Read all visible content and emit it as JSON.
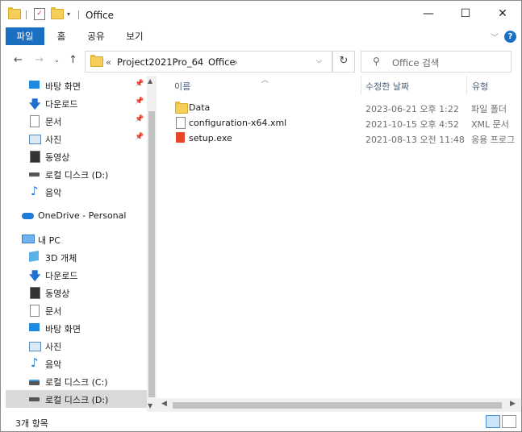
{
  "window": {
    "title": "Office"
  },
  "ribbon": {
    "tabs": [
      "파일",
      "홈",
      "공유",
      "보기"
    ],
    "help": "?"
  },
  "address": {
    "overflow": "«",
    "crumbs": [
      "Project2021Pro_64",
      "Office"
    ],
    "separator": "›"
  },
  "search": {
    "placeholder": "Office 검색"
  },
  "sidebar": {
    "quick_access": [
      {
        "label": "바탕 화면",
        "icon": "desktop-icon",
        "pinned": true
      },
      {
        "label": "다운로드",
        "icon": "download-icon",
        "pinned": true
      },
      {
        "label": "문서",
        "icon": "documents-icon",
        "pinned": true
      },
      {
        "label": "사진",
        "icon": "pictures-icon",
        "pinned": true
      },
      {
        "label": "동영상",
        "icon": "videos-icon",
        "pinned": false
      },
      {
        "label": "로컬 디스크 (D:)",
        "icon": "drive-icon",
        "pinned": false
      },
      {
        "label": "음악",
        "icon": "music-icon",
        "pinned": false
      }
    ],
    "onedrive": "OneDrive - Personal",
    "this_pc": "내 PC",
    "pc_items": [
      {
        "label": "3D 개체",
        "icon": "3d-objects-icon"
      },
      {
        "label": "다운로드",
        "icon": "download-icon"
      },
      {
        "label": "동영상",
        "icon": "videos-icon"
      },
      {
        "label": "문서",
        "icon": "documents-icon"
      },
      {
        "label": "바탕 화면",
        "icon": "desktop-icon"
      },
      {
        "label": "사진",
        "icon": "pictures-icon"
      },
      {
        "label": "음악",
        "icon": "music-icon"
      },
      {
        "label": "로컬 디스크 (C:)",
        "icon": "system-drive-icon"
      },
      {
        "label": "로컬 디스크 (D:)",
        "icon": "drive-icon",
        "selected": true
      }
    ]
  },
  "columns": {
    "name": "이름",
    "date": "수정한 날짜",
    "type": "유형"
  },
  "files": [
    {
      "name": "Data",
      "date": "2023-06-21 오후 1:22",
      "type": "파일 폴더",
      "icon": "folder-icon"
    },
    {
      "name": "configuration-x64.xml",
      "date": "2021-10-15 오후 4:52",
      "type": "XML 문서",
      "icon": "xml-file-icon"
    },
    {
      "name": "setup.exe",
      "date": "2021-08-13 오전 11:48",
      "type": "응용 프로그",
      "icon": "office-app-icon"
    }
  ],
  "status": {
    "count": "3개 항목"
  },
  "colors": {
    "accent": "#1a6fc2",
    "folder": "#f6cf5a",
    "office": "#e8462b",
    "selected": "#d9d9d9"
  }
}
